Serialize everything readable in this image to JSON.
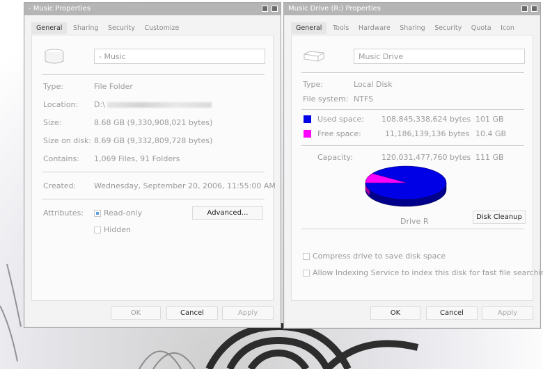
{
  "left_window": {
    "title": "- Music Properties",
    "tabs": [
      "General",
      "Sharing",
      "Security",
      "Customize"
    ],
    "name_value": "- Music",
    "fields": [
      {
        "label": "Type:",
        "value": "File Folder"
      },
      {
        "label": "Location:",
        "value": "D:\\"
      },
      {
        "label": "Size:",
        "value": "8.68 GB (9,330,908,021 bytes)"
      },
      {
        "label": "Size on disk:",
        "value": "8.69 GB (9,332,809,728 bytes)"
      },
      {
        "label": "Contains:",
        "value": "1,069 Files, 91 Folders"
      }
    ],
    "created_label": "Created:",
    "created_value": "Wednesday, September 20, 2006, 11:55:00 AM",
    "attributes_label": "Attributes:",
    "readonly_label": "Read-only",
    "hidden_label": "Hidden",
    "advanced_label": "Advanced...",
    "ok_label": "OK",
    "cancel_label": "Cancel",
    "apply_label": "Apply"
  },
  "right_window": {
    "title": "Music Drive (R:) Properties",
    "tabs": [
      "General",
      "Tools",
      "Hardware",
      "Sharing",
      "Security",
      "Quota",
      "Icon"
    ],
    "name_value": "Music Drive",
    "type_label": "Type:",
    "type_value": "Local Disk",
    "fs_label": "File system:",
    "fs_value": "NTFS",
    "used_label": "Used space:",
    "used_bytes": "108,845,338,624 bytes",
    "used_size": "101 GB",
    "used_color": "#0000e6",
    "free_label": "Free space:",
    "free_bytes": "11,186,139,136 bytes",
    "free_size": "10.4 GB",
    "free_color": "#ff00ff",
    "capacity_label": "Capacity:",
    "capacity_bytes": "120,031,477,760 bytes",
    "capacity_size": "111 GB",
    "drive_label": "Drive R",
    "cleanup_label": "Disk Cleanup",
    "compress_label": "Compress drive to save disk space",
    "index_label": "Allow Indexing Service to index this disk for fast file searching",
    "ok_label": "OK",
    "cancel_label": "Cancel",
    "apply_label": "Apply"
  }
}
